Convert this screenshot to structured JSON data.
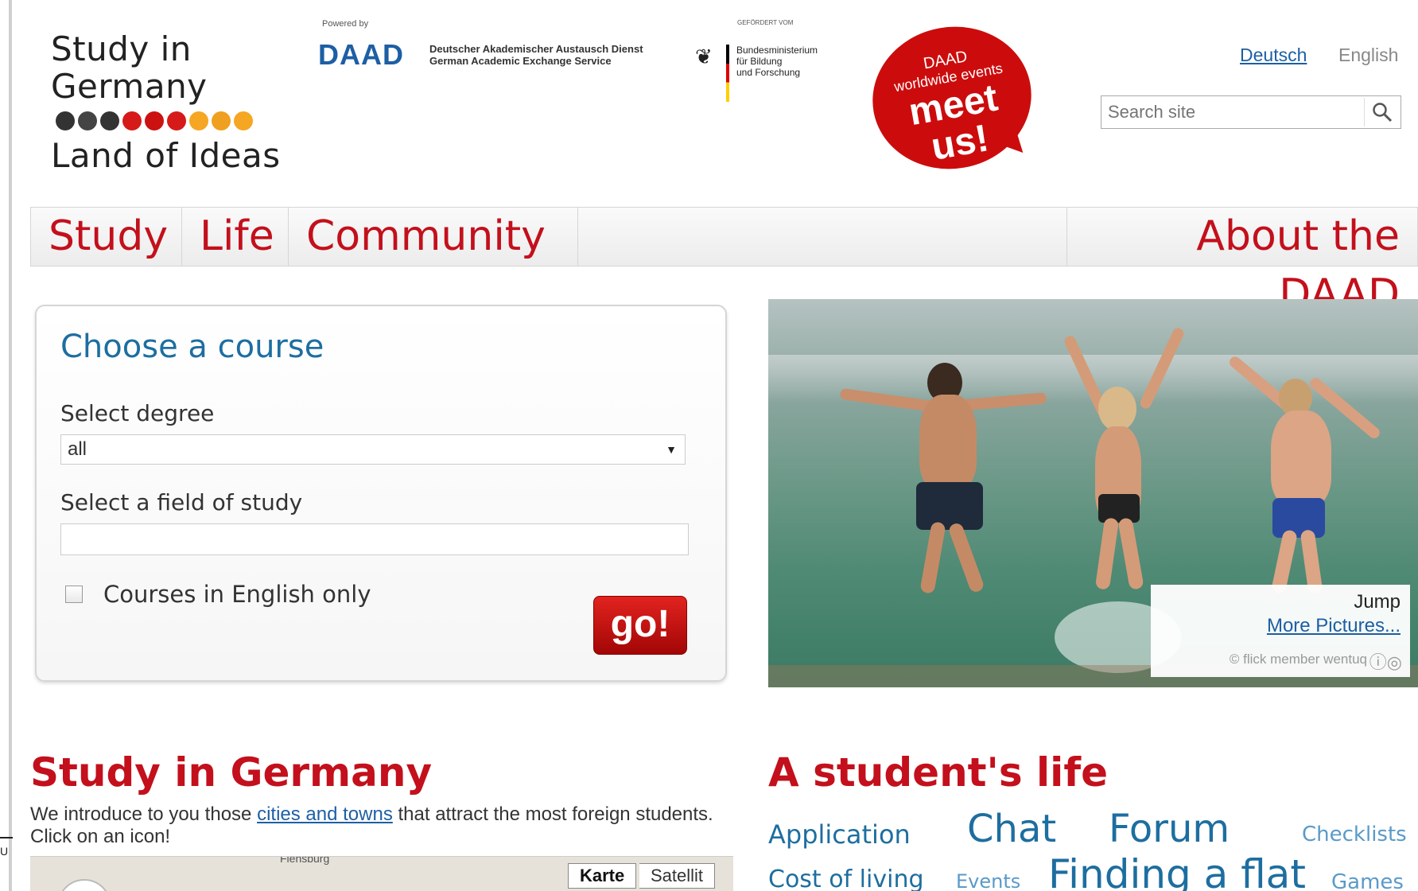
{
  "header": {
    "logo_lines": [
      "Study in",
      "Germany",
      "Land of Ideas"
    ],
    "logo_dot_colors": [
      "#333333",
      "#444444",
      "#333333",
      "#d61a1a",
      "#cc1111",
      "#d61a1a",
      "#f5a623",
      "#f0a020",
      "#f5a623"
    ],
    "powered_by": "Powered by",
    "daad_logo": "DAAD",
    "daad_name_de": "Deutscher Akademischer Austausch Dienst",
    "daad_name_en": "German Academic Exchange Service",
    "gefoerdert": "GEFÖRDERT VOM",
    "bmbf_line1": "Bundesministerium",
    "bmbf_line2": "für Bildung",
    "bmbf_line3": "und Forschung",
    "meetus_line1": "DAAD",
    "meetus_line2": "worldwide events",
    "meetus_line3": "meet",
    "meetus_line4": "us!",
    "lang_de": "Deutsch",
    "lang_en": "English",
    "search_placeholder": "Search site",
    "search_icon": "search-icon"
  },
  "nav": {
    "study": "Study",
    "life": "Life",
    "community": "Community",
    "about": "About the DAAD"
  },
  "course": {
    "title": "Choose a course",
    "degree_label": "Select degree",
    "degree_value": "all",
    "field_label": "Select a field of study",
    "field_value": "",
    "english_only_label": "Courses in English only",
    "go_label": "go!"
  },
  "photo": {
    "caption_title": "Jump",
    "more_pictures": "More Pictures...",
    "credit": "© flick member wentuq"
  },
  "study_section": {
    "title": "Study in Germany",
    "intro_before": "We introduce to you those ",
    "intro_link": "cities and towns",
    "intro_after": " that attract the most foreign students. Click on an icon!",
    "map_town": "Flensburg",
    "map_karte": "Karte",
    "map_satellit": "Satellit"
  },
  "life_section": {
    "title": "A student's life",
    "tags": {
      "application": "Application",
      "chat": "Chat",
      "forum": "Forum",
      "checklists": "Checklists",
      "cost_of_living": "Cost of living",
      "events": "Events",
      "finding_a_flat": "Finding a flat",
      "games": "Games"
    }
  }
}
